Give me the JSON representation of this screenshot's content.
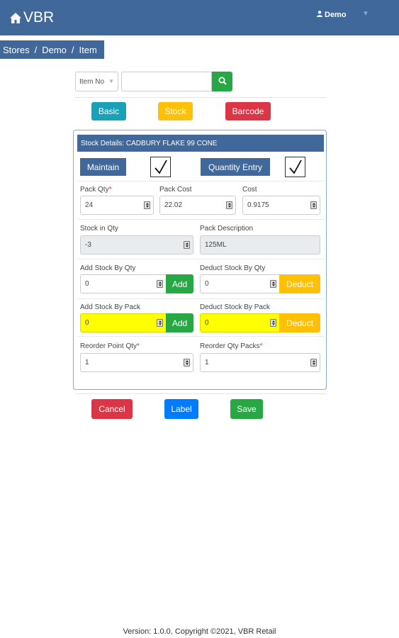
{
  "navbar": {
    "brand": "VBR",
    "brand_icon": "home-icon",
    "user_name": "Demo",
    "user_icon": "user-icon",
    "dropdown_icon": "caret-down-icon"
  },
  "breadcrumb": {
    "items": [
      "Stores",
      "Demo",
      "Item"
    ],
    "separator": "/"
  },
  "search": {
    "select_value": "Item No",
    "input_value": "",
    "button_icon": "search-icon"
  },
  "tabs": {
    "basic": "Basic",
    "stock": "Stock",
    "barcode": "Barcode"
  },
  "card": {
    "header": "Stock Details: CADBURY FLAKE 99 CONE",
    "maintain_label": "Maintain",
    "maintain_checked": true,
    "quantity_entry_label": "Quantity Entry",
    "quantity_entry_checked": true
  },
  "fields": {
    "pack_qty": {
      "label": "Pack Qty",
      "value": "24",
      "required": "*"
    },
    "pack_cost": {
      "label": "Pack Cost",
      "value": "22.02"
    },
    "cost": {
      "label": "Cost",
      "value": "0.9175"
    },
    "stock_in_qty": {
      "label": "Stock in Qty",
      "value": "-3"
    },
    "pack_description": {
      "label": "Pack Description",
      "value": "125ML"
    },
    "add_stock_by_qty": {
      "label": "Add Stock By Qty",
      "value": "0",
      "button": "Add"
    },
    "deduct_stock_by_qty": {
      "label": "Deduct Stock By Qty",
      "value": "0",
      "button": "Deduct"
    },
    "add_stock_by_pack": {
      "label": "Add Stock By Pack",
      "value": "0",
      "button": "Add"
    },
    "deduct_stock_by_pack": {
      "label": "Deduct Stock By Pack",
      "value": "0",
      "button": "Deduct"
    },
    "reorder_point_qty": {
      "label": "Reorder Point Qty",
      "value": "1",
      "required": "*"
    },
    "reorder_qty_packs": {
      "label": "Reorder Qty Packs",
      "value": "1",
      "required": "*"
    }
  },
  "actions": {
    "cancel": "Cancel",
    "label": "Label",
    "save": "Save"
  },
  "footer": {
    "text": "Version: 1.0.0, Copyright ©2021, VBR Retail"
  },
  "colors": {
    "primary_blue": "#41689a",
    "success_green": "#28a745",
    "warning_yellow": "#ffc107",
    "danger_red": "#dc3545",
    "info_teal": "#17a2b8",
    "label_blue": "#007bff",
    "highlight_yellow": "#ffff00"
  }
}
